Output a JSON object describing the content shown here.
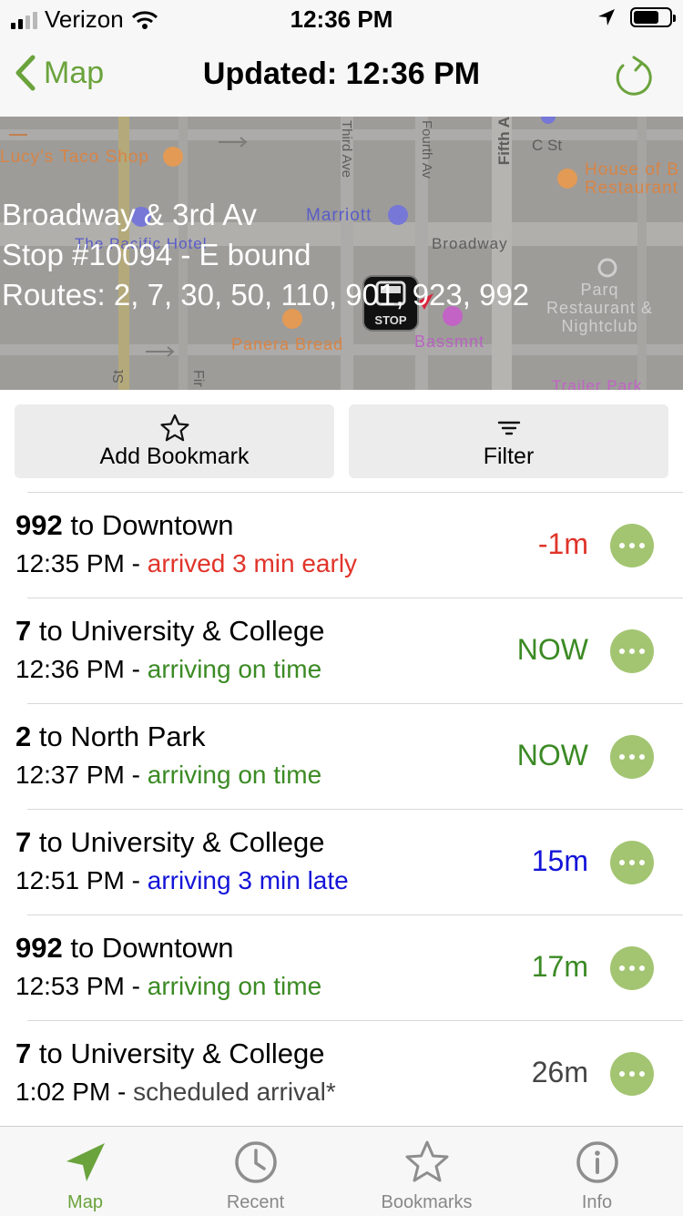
{
  "status_bar": {
    "carrier": "Verizon",
    "time": "12:36 PM",
    "battery_level": 0.7
  },
  "nav": {
    "back_label": "Map",
    "title": "Updated: 12:36 PM"
  },
  "map": {
    "labels": {
      "lucys": "Lucy's Taco Shop",
      "house": "House of B",
      "house2": "Restaurant",
      "marriott": "Marriott",
      "hotel": "The Pacific Hotel",
      "broadway": "Broadway",
      "parq1": "Parq",
      "parq2": "Restaurant &",
      "parq3": "Nightclub",
      "panera": "Panera Bread",
      "bassmnt": "Bassmnt",
      "trailer": "Trailer Park",
      "third": "Third Ave",
      "fourth": "Fourth Av",
      "fifth": "Fifth A",
      "cst": "C St",
      "st": "St",
      "fir": "Fir"
    },
    "stop_marker_label": "STOP"
  },
  "stop": {
    "name": "Broadway & 3rd Av",
    "number": "Stop #10094 - E bound",
    "routes": "Routes: 2, 7, 30, 50, 110, 901, 923, 992"
  },
  "actions": {
    "bookmark_label": "Add Bookmark",
    "filter_label": "Filter"
  },
  "arrivals": [
    {
      "route": "992",
      "dest": " to Downtown",
      "time": "12:35 PM",
      "sep": " - ",
      "status": "arrived 3 min early",
      "eta": "-1m",
      "color": "#e0342a"
    },
    {
      "route": "7",
      "dest": " to University & College",
      "time": "12:36 PM",
      "sep": " - ",
      "status": "arriving on time",
      "eta": "NOW",
      "color": "#3b8a24"
    },
    {
      "route": "2",
      "dest": " to North Park",
      "time": "12:37 PM",
      "sep": " - ",
      "status": "arriving on time",
      "eta": "NOW",
      "color": "#3b8a24"
    },
    {
      "route": "7",
      "dest": " to University & College",
      "time": "12:51 PM",
      "sep": " - ",
      "status": "arriving 3 min late",
      "eta": "15m",
      "color": "#1414d8"
    },
    {
      "route": "992",
      "dest": " to Downtown",
      "time": "12:53 PM",
      "sep": " - ",
      "status": "arriving on time",
      "eta": "17m",
      "color": "#3b8a24"
    },
    {
      "route": "7",
      "dest": " to University & College",
      "time": "1:02 PM",
      "sep": " - ",
      "status": "scheduled arrival*",
      "eta": "26m",
      "color": "#444444"
    }
  ],
  "tabs": [
    {
      "label": "Map",
      "icon": "location-arrow-icon",
      "active": true
    },
    {
      "label": "Recent",
      "icon": "clock-icon",
      "active": false
    },
    {
      "label": "Bookmarks",
      "icon": "star-icon",
      "active": false
    },
    {
      "label": "Info",
      "icon": "info-icon",
      "active": false
    }
  ],
  "colors": {
    "accent": "#6aa33c",
    "more_button": "#a3c572",
    "early": "#e0342a",
    "on_time": "#3b8a24",
    "late": "#1414d8"
  }
}
